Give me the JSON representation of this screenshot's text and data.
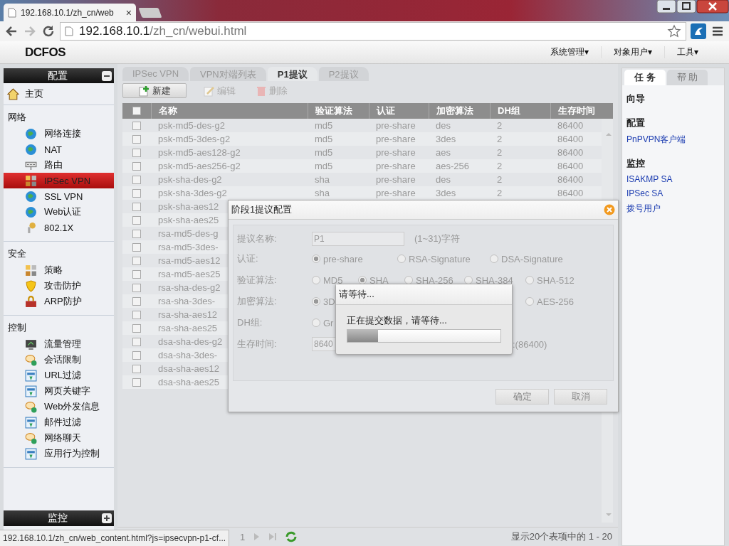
{
  "browser": {
    "tab_title": "192.168.10.1/zh_cn/web",
    "tab_close": "×",
    "url_host": "192.168.10.1",
    "url_path": "/zh_cn/webui.html"
  },
  "app": {
    "logo": "DCFOS",
    "menus": [
      "系统管理▾",
      "对象用户▾",
      "工具▾"
    ]
  },
  "sidebar": {
    "title": "配置",
    "home": {
      "label": "主页",
      "selected": false
    },
    "groups": [
      {
        "label": "网络",
        "items": [
          {
            "label": "网络连接",
            "selected": false
          },
          {
            "label": "NAT",
            "selected": false
          },
          {
            "label": "路由",
            "selected": false
          },
          {
            "label": "IPSec VPN",
            "selected": true
          },
          {
            "label": "SSL VPN",
            "selected": false
          },
          {
            "label": "Web认证",
            "selected": false
          },
          {
            "label": "802.1X",
            "selected": false
          }
        ]
      },
      {
        "label": "安全",
        "items": [
          {
            "label": "策略",
            "selected": false
          },
          {
            "label": "攻击防护",
            "selected": false
          },
          {
            "label": "ARP防护",
            "selected": false
          }
        ]
      },
      {
        "label": "控制",
        "items": [
          {
            "label": "流量管理",
            "selected": false
          },
          {
            "label": "会话限制",
            "selected": false
          },
          {
            "label": "URL过滤",
            "selected": false
          },
          {
            "label": "网页关键字",
            "selected": false
          },
          {
            "label": "Web外发信息",
            "selected": false
          },
          {
            "label": "邮件过滤",
            "selected": false
          },
          {
            "label": "网络聊天",
            "selected": false
          },
          {
            "label": "应用行为控制",
            "selected": false
          }
        ]
      }
    ],
    "footer": "监控"
  },
  "tabs": [
    {
      "label": "IPSec VPN",
      "selected": false
    },
    {
      "label": "VPN对端列表",
      "selected": false
    },
    {
      "label": "P1提议",
      "selected": true
    },
    {
      "label": "P2提议",
      "selected": false
    }
  ],
  "toolbar": [
    {
      "kind": "add",
      "label": "新建",
      "disabled": false
    },
    {
      "kind": "edit",
      "label": "编辑",
      "disabled": true
    },
    {
      "kind": "delete",
      "label": "删除",
      "disabled": true
    }
  ],
  "table": {
    "header_checked": false,
    "columns": [
      "名称",
      "验证算法",
      "认证",
      "加密算法",
      "DH组",
      "生存时间"
    ],
    "rows": [
      {
        "checked": false,
        "cells": [
          "psk-md5-des-g2",
          "md5",
          "pre-share",
          "des",
          "2",
          "86400"
        ]
      },
      {
        "checked": false,
        "cells": [
          "psk-md5-3des-g2",
          "md5",
          "pre-share",
          "3des",
          "2",
          "86400"
        ]
      },
      {
        "checked": false,
        "cells": [
          "psk-md5-aes128-g2",
          "md5",
          "pre-share",
          "aes",
          "2",
          "86400"
        ]
      },
      {
        "checked": false,
        "cells": [
          "psk-md5-aes256-g2",
          "md5",
          "pre-share",
          "aes-256",
          "2",
          "86400"
        ]
      },
      {
        "checked": false,
        "cells": [
          "psk-sha-des-g2",
          "sha",
          "pre-share",
          "des",
          "2",
          "86400"
        ]
      },
      {
        "checked": false,
        "cells": [
          "psk-sha-3des-g2",
          "sha",
          "pre-share",
          "3des",
          "2",
          "86400"
        ]
      },
      {
        "checked": false,
        "cells": [
          "psk-sha-aes12"
        ]
      },
      {
        "checked": false,
        "cells": [
          "psk-sha-aes25"
        ]
      },
      {
        "checked": false,
        "cells": [
          "rsa-md5-des-g"
        ]
      },
      {
        "checked": false,
        "cells": [
          "rsa-md5-3des-"
        ]
      },
      {
        "checked": false,
        "cells": [
          "rsa-md5-aes12"
        ]
      },
      {
        "checked": false,
        "cells": [
          "rsa-md5-aes25"
        ]
      },
      {
        "checked": false,
        "cells": [
          "rsa-sha-des-g2"
        ]
      },
      {
        "checked": false,
        "cells": [
          "rsa-sha-3des-"
        ]
      },
      {
        "checked": false,
        "cells": [
          "rsa-sha-aes12"
        ]
      },
      {
        "checked": false,
        "cells": [
          "rsa-sha-aes25"
        ]
      },
      {
        "checked": false,
        "cells": [
          "dsa-sha-des-g2"
        ]
      },
      {
        "checked": false,
        "cells": [
          "dsa-sha-3des-"
        ]
      },
      {
        "checked": false,
        "cells": [
          "dsa-sha-aes12"
        ]
      },
      {
        "checked": false,
        "cells": [
          "dsa-sha-aes25"
        ]
      }
    ]
  },
  "pager": {
    "page": "1",
    "summary": "显示20个表项中的 1 - 20"
  },
  "right_panel": {
    "tabs": [
      {
        "label": "任 务",
        "selected": true
      },
      {
        "label": "帮 助",
        "selected": false
      }
    ],
    "sections": [
      {
        "heading": "向导"
      },
      {
        "heading": "配置",
        "links": [
          "PnPVPN客户端"
        ]
      },
      {
        "heading": "监控",
        "links": [
          "ISAKMP SA",
          "IPSec SA",
          "拨号用户"
        ]
      }
    ]
  },
  "dialog": {
    "title": "阶段1提议配置",
    "fields": [
      {
        "kind": "text",
        "label": "提议名称:",
        "value": "P1",
        "hint": "(1~31)字符"
      },
      {
        "kind": "radio",
        "label": "认证:",
        "options": [
          {
            "label": "pre-share",
            "selected": true
          },
          {
            "label": "RSA-Signature",
            "selected": false
          },
          {
            "label": "DSA-Signature",
            "selected": false
          }
        ]
      },
      {
        "kind": "radio",
        "label": "验证算法:",
        "options": [
          {
            "label": "MD5",
            "selected": false
          },
          {
            "label": "SHA",
            "selected": true
          },
          {
            "label": "SHA-256",
            "selected": false
          },
          {
            "label": "SHA-384",
            "selected": false
          },
          {
            "label": "SHA-512",
            "selected": false
          }
        ]
      },
      {
        "kind": "radio",
        "label": "加密算法:",
        "options": [
          {
            "label": "3D",
            "selected": true
          },
          {
            "label": "AES-256",
            "selected": false
          }
        ]
      },
      {
        "kind": "radio",
        "label": "DH组:",
        "options": [
          {
            "label": "Gr",
            "selected": false
          }
        ]
      },
      {
        "kind": "text",
        "label": "生存时间:",
        "value": "8640",
        "hint": ":(86400)"
      }
    ],
    "buttons": [
      "确定",
      "取消"
    ]
  },
  "wait": {
    "title": "请等待...",
    "message": "正在提交数据，请等待...",
    "level": 0.2
  },
  "status_url": "192.168.10.1/zh_cn/web_content.html?js=ipsecvpn-p1-cf..."
}
